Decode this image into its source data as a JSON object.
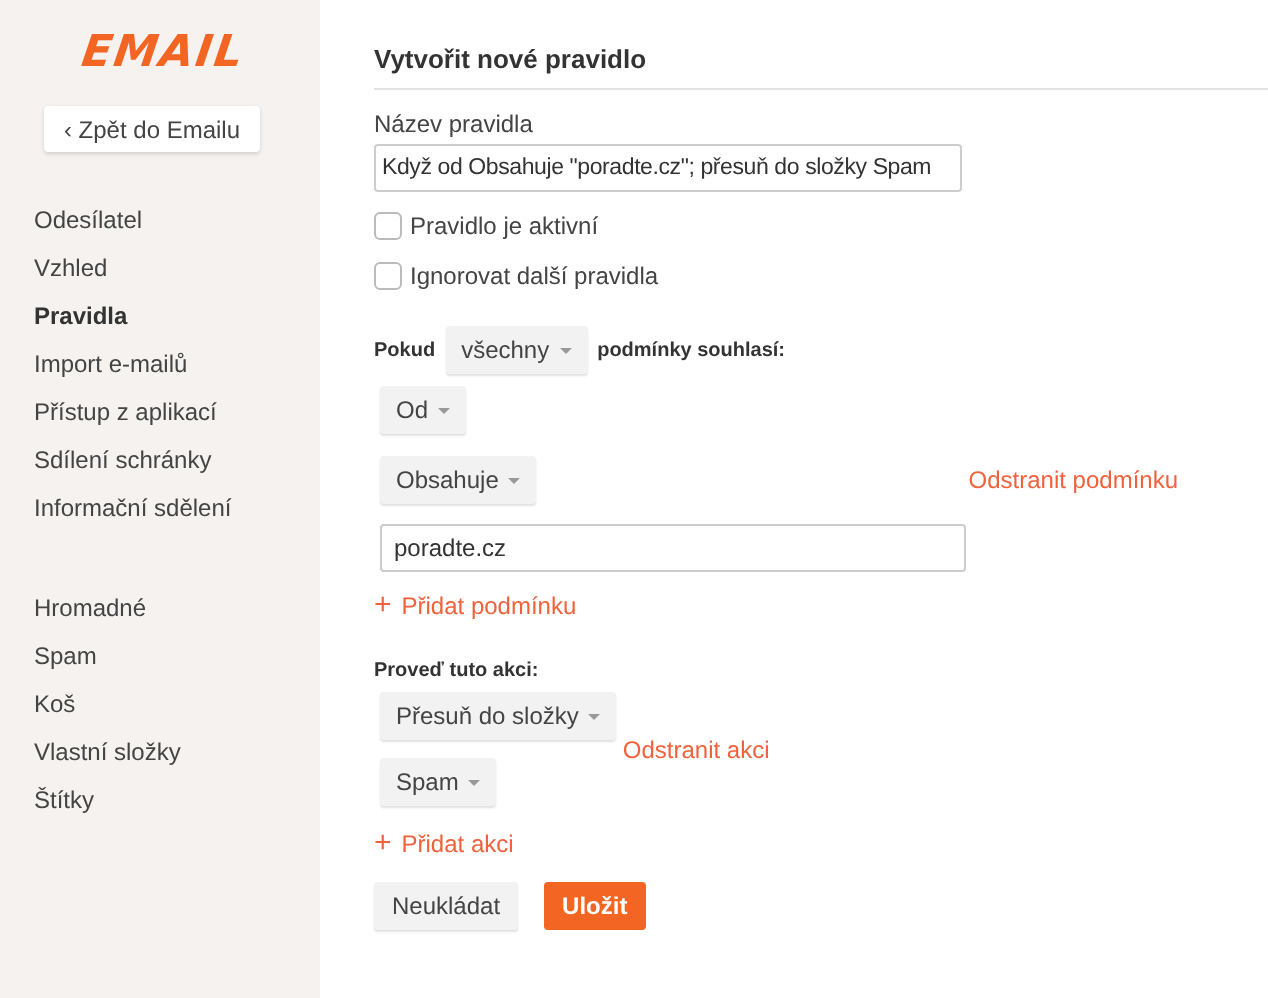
{
  "sidebar": {
    "logo": "EMAIL",
    "back_button": "‹ Zpět do Emailu",
    "groups": [
      [
        {
          "label": "Odesílatel",
          "selected": false
        },
        {
          "label": "Vzhled",
          "selected": false
        },
        {
          "label": "Pravidla",
          "selected": true
        },
        {
          "label": "Import e-mailů",
          "selected": false
        },
        {
          "label": "Přístup z aplikací",
          "selected": false
        },
        {
          "label": "Sdílení schránky",
          "selected": false
        },
        {
          "label": "Informační sdělení",
          "selected": false
        }
      ],
      [
        {
          "label": "Hromadné",
          "selected": false
        },
        {
          "label": "Spam",
          "selected": false
        },
        {
          "label": "Koš",
          "selected": false
        },
        {
          "label": "Vlastní složky",
          "selected": false
        },
        {
          "label": "Štítky",
          "selected": false
        }
      ]
    ]
  },
  "form": {
    "title": "Vytvořit nové pravidlo",
    "name_label": "Název pravidla",
    "name_value": "Když od Obsahuje \"poradte.cz\"; přesuň do složky Spam",
    "checkboxes": [
      {
        "label": "Pravidlo je aktivní",
        "checked": false
      },
      {
        "label": "Ignorovat další pravidla",
        "checked": false
      }
    ],
    "match_prefix": "Pokud",
    "match_mode": "všechny",
    "match_suffix": "podmínky souhlasí:",
    "condition": {
      "field": "Od",
      "operator": "Obsahuje",
      "remove": "Odstranit podmínku",
      "value": "poradte.cz"
    },
    "add_condition": {
      "icon": "+",
      "label": "Přidat podmínku"
    },
    "actions_label": "Proveď tuto akci:",
    "action": {
      "type": "Přesuň do složky",
      "remove": "Odstranit akci",
      "folder": "Spam"
    },
    "add_action": {
      "icon": "+",
      "label": "Přidat akci"
    },
    "buttons": [
      {
        "label": "Neukládat",
        "kind": "secondary"
      },
      {
        "label": "Uložit",
        "kind": "primary"
      }
    ]
  }
}
